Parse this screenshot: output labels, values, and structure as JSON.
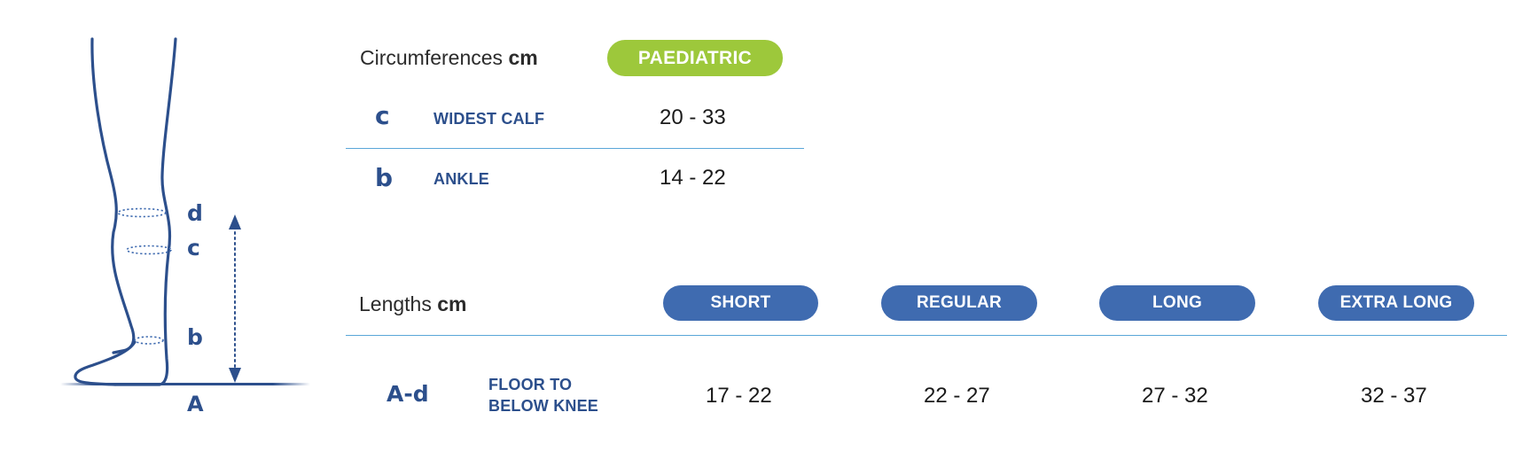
{
  "colors": {
    "brand_blue": "#3f6bb0",
    "text_blue": "#2c4f8c",
    "accent_green": "#9dc83b",
    "rule_blue": "#5aa7d8"
  },
  "diagram": {
    "markers": {
      "d": "d",
      "c": "c",
      "b": "b",
      "A": "A"
    }
  },
  "circumferences": {
    "heading_prefix": "Circumferences",
    "heading_unit": "cm",
    "badge": "PAEDIATRIC",
    "rows": [
      {
        "letter": "c",
        "label": "WIDEST CALF",
        "value": "20 - 33"
      },
      {
        "letter": "b",
        "label": "ANKLE",
        "value": "14 - 22"
      }
    ]
  },
  "lengths": {
    "heading_prefix": "Lengths",
    "heading_unit": "cm",
    "sizes": [
      "SHORT",
      "REGULAR",
      "LONG",
      "EXTRA LONG"
    ],
    "row": {
      "letter": "A-d",
      "label_line1": "FLOOR TO",
      "label_line2": "BELOW KNEE",
      "values": [
        "17 - 22",
        "22 - 27",
        "27 - 32",
        "32 - 37"
      ]
    }
  }
}
